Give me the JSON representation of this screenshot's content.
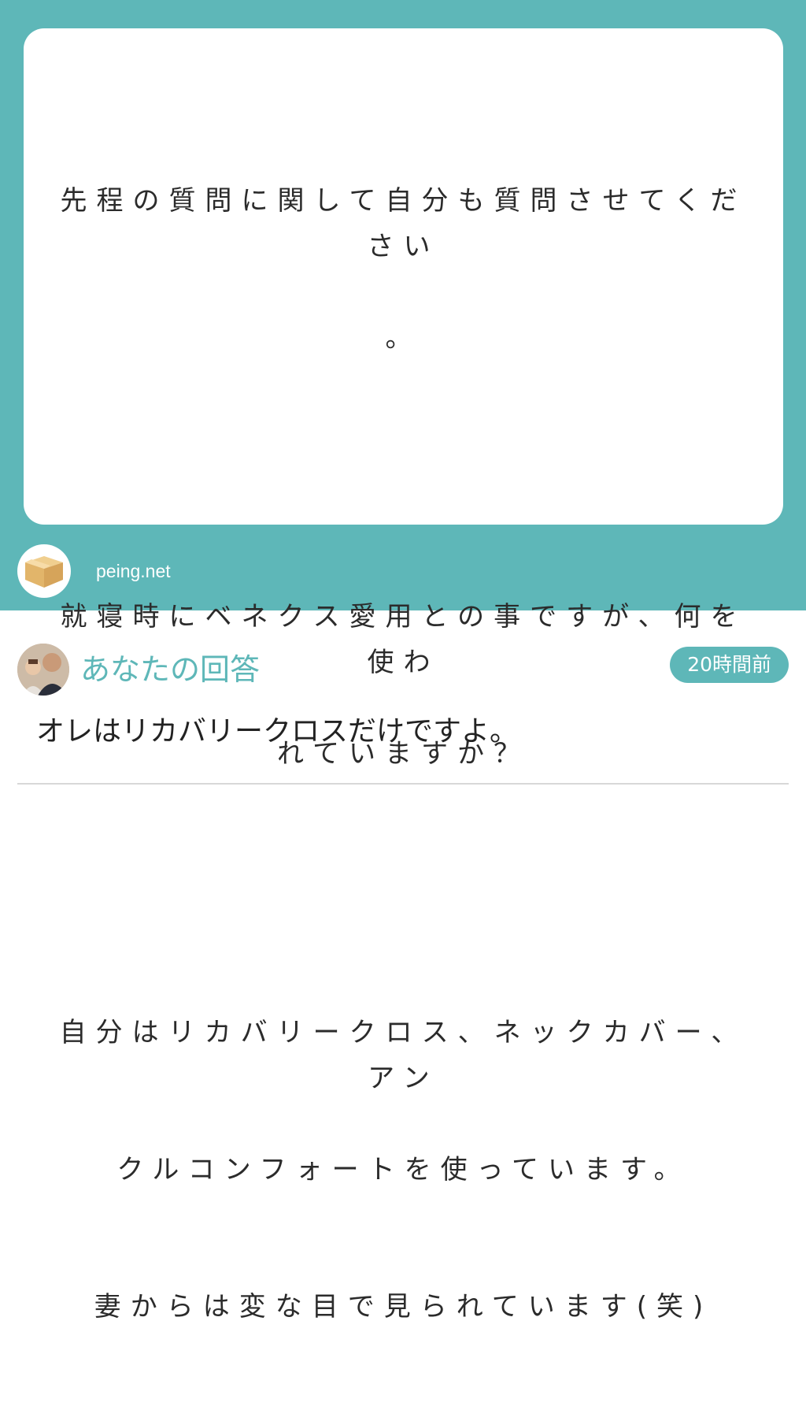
{
  "question": {
    "lines": [
      "先程の質問に関して自分も質問させてください",
      "。",
      "",
      "就寝時にベネクス愛用との事ですが、何を使わ",
      "れていますか？",
      "",
      "自分はリカバリークロス、ネックカバー、アン",
      "クルコンフォートを使っています。",
      "妻からは変な目で見られています(笑)"
    ]
  },
  "site": {
    "name": "peing.net",
    "icon": "cardboard-box-icon"
  },
  "answer": {
    "label": "あなたの回答",
    "time": "20時間前",
    "text": "オレはリカバリークロスだけですよ。",
    "avatar_icon": "user-photo-avatar"
  },
  "colors": {
    "accent": "#5eb7b8",
    "card": "#ffffff",
    "text": "#2b2b2b"
  }
}
